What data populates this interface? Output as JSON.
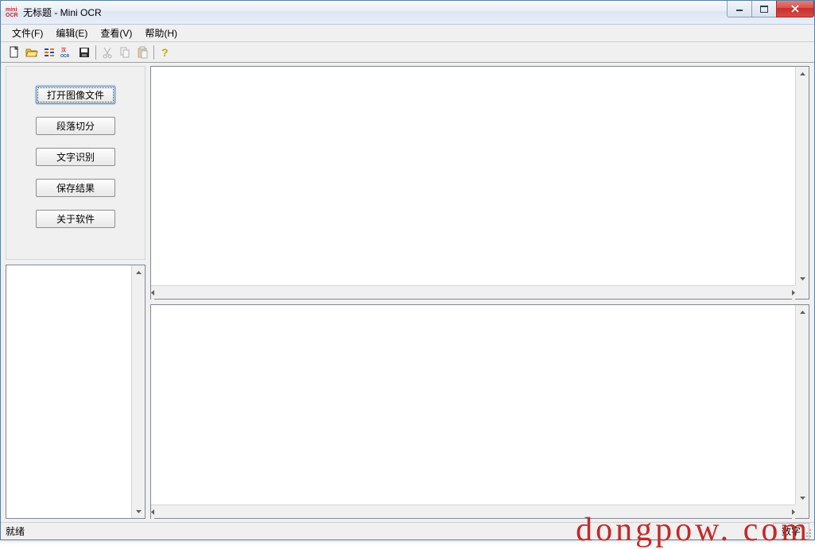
{
  "app_icon": {
    "line1": "mini",
    "line2": "OCR"
  },
  "title": "无标题 - Mini OCR",
  "menu": {
    "file": "文件(F)",
    "edit": "编辑(E)",
    "view": "查看(V)",
    "help": "帮助(H)"
  },
  "sidebar": {
    "buttons": {
      "open_image": "打开图像文件",
      "segment": "段落切分",
      "recognize": "文字识别",
      "save_result": "保存结果",
      "about": "关于软件"
    }
  },
  "status": {
    "ready": "就绪",
    "numlock": "数字"
  },
  "watermark": "dongpow. com",
  "toolbar_icons": {
    "new": "new-file-icon",
    "open": "open-folder-icon",
    "segment": "segment-icon",
    "ocr": "ocr-icon",
    "save": "save-icon",
    "cut": "cut-icon",
    "copy": "copy-icon",
    "paste": "paste-icon",
    "help": "help-icon"
  }
}
